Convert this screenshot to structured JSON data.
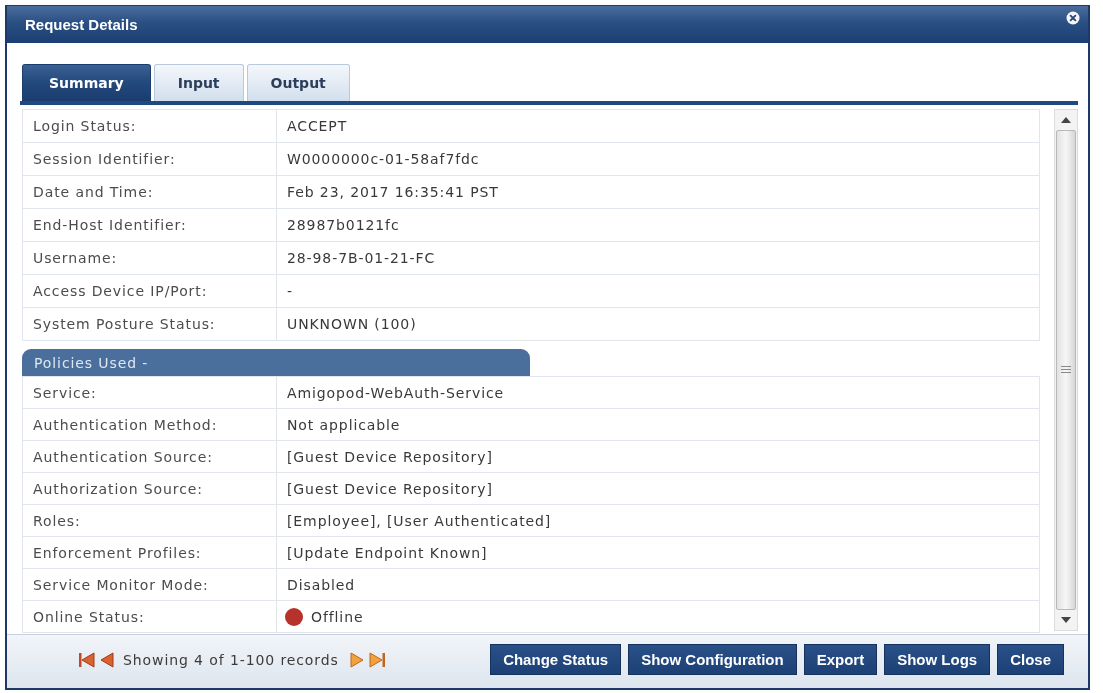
{
  "window": {
    "title": "Request Details"
  },
  "tabs": [
    {
      "label": "Summary",
      "selected": true
    },
    {
      "label": "Input",
      "selected": false
    },
    {
      "label": "Output",
      "selected": false
    }
  ],
  "summary": {
    "rows": [
      {
        "label": "Login Status:",
        "value": "ACCEPT"
      },
      {
        "label": "Session Identifier:",
        "value": "W0000000c-01-58af7fdc"
      },
      {
        "label": "Date and Time:",
        "value": "Feb 23, 2017 16:35:41 PST"
      },
      {
        "label": "End-Host Identifier:",
        "value": "28987b0121fc"
      },
      {
        "label": "Username:",
        "value": "28-98-7B-01-21-FC"
      },
      {
        "label": "Access Device IP/Port:",
        "value": "-"
      },
      {
        "label": "System Posture Status:",
        "value": "UNKNOWN (100)"
      }
    ]
  },
  "policies": {
    "title": "Policies Used -",
    "rows": [
      {
        "kind": "text",
        "label": "Service:",
        "value": "Amigopod-WebAuth-Service"
      },
      {
        "kind": "text",
        "label": "Authentication Method:",
        "value": "Not applicable"
      },
      {
        "kind": "text",
        "label": "Authentication Source:",
        "value": "[Guest Device Repository]"
      },
      {
        "kind": "text",
        "label": "Authorization Source:",
        "value": "[Guest Device Repository]"
      },
      {
        "kind": "text",
        "label": "Roles:",
        "value": "[Employee], [User Authenticated]"
      },
      {
        "kind": "text",
        "label": "Enforcement Profiles:",
        "value": "[Update Endpoint Known]"
      },
      {
        "kind": "text",
        "label": "Service Monitor Mode:",
        "value": "Disabled"
      },
      {
        "kind": "status",
        "label": "Online Status:",
        "value": "Offline",
        "color": "#b8322c"
      }
    ]
  },
  "footer": {
    "pager_text": "Showing 4 of 1-100 records",
    "buttons": [
      "Change Status",
      "Show Configuration",
      "Export",
      "Show Logs",
      "Close"
    ]
  }
}
